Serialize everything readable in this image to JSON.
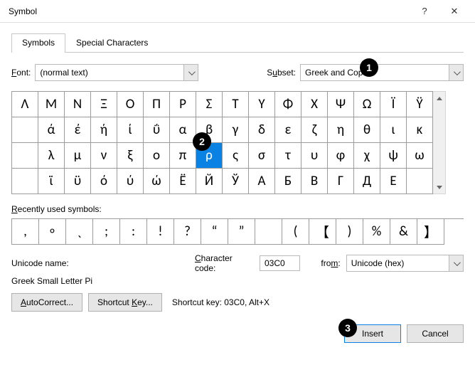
{
  "window": {
    "title": "Symbol",
    "help_icon": "?",
    "close_icon": "✕"
  },
  "tabs": {
    "symbols": "Symbols",
    "special": "Special Characters"
  },
  "font": {
    "label": "Font:",
    "value": "(normal text)"
  },
  "subset": {
    "label": "Subset:",
    "value": "Greek and Coptic"
  },
  "grid": [
    "Λ",
    "Μ",
    "Ν",
    "Ξ",
    "Ο",
    "Π",
    "Ρ",
    "Σ",
    "Τ",
    "Υ",
    "Φ",
    "Χ",
    "Ψ",
    "Ω",
    "Ϊ",
    "Ϋ",
    "ά",
    "έ",
    "ή",
    "ί",
    "ΰ",
    "α",
    "β",
    "γ",
    "δ",
    "ε",
    "ζ",
    "η",
    "θ",
    "ι",
    "κ",
    "λ",
    "μ",
    "ν",
    "ξ",
    "ο",
    "π",
    "ρ",
    "ς",
    "σ",
    "τ",
    "υ",
    "φ",
    "χ",
    "ψ",
    "ω",
    "ϊ",
    "ϋ",
    "ό",
    "ύ",
    "ώ",
    "Ё",
    "Й",
    "Ў",
    "А",
    "Б",
    "В",
    "Г",
    "Д",
    "Е"
  ],
  "grid_layout": [
    [
      0,
      1,
      2,
      3,
      4,
      5,
      6,
      7,
      8,
      9,
      10,
      11,
      12,
      13,
      14,
      15
    ],
    [
      -1,
      16,
      17,
      18,
      19,
      20,
      21,
      22,
      23,
      24,
      25,
      26,
      27,
      28,
      29,
      30
    ],
    [
      -1,
      31,
      32,
      33,
      34,
      35,
      36,
      37,
      38,
      39,
      40,
      41,
      42,
      43,
      44,
      45
    ],
    [
      -1,
      46,
      47,
      48,
      49,
      50,
      51,
      52,
      53,
      54,
      55,
      56,
      57,
      58,
      59,
      60
    ]
  ],
  "selected_index": 37,
  "recent": {
    "label": "Recently used symbols:",
    "items": [
      ",",
      "∘",
      "ˎ",
      ";",
      ":",
      "!",
      "?",
      "“",
      "”",
      "",
      "(",
      "【",
      ")",
      "%",
      "&",
      "】"
    ]
  },
  "unicode": {
    "name_label": "Unicode name:",
    "name_value": "Greek Small Letter Pi",
    "code_label": "Character code:",
    "code_value": "03C0",
    "from_label": "from:",
    "from_value": "Unicode (hex)"
  },
  "buttons": {
    "autocorrect": "AutoCorrect...",
    "shortcut": "Shortcut Key...",
    "shortcut_info": "Shortcut key: 03C0, Alt+X",
    "insert": "Insert",
    "cancel": "Cancel"
  },
  "markers": {
    "m1": "1",
    "m2": "2",
    "m3": "3"
  }
}
